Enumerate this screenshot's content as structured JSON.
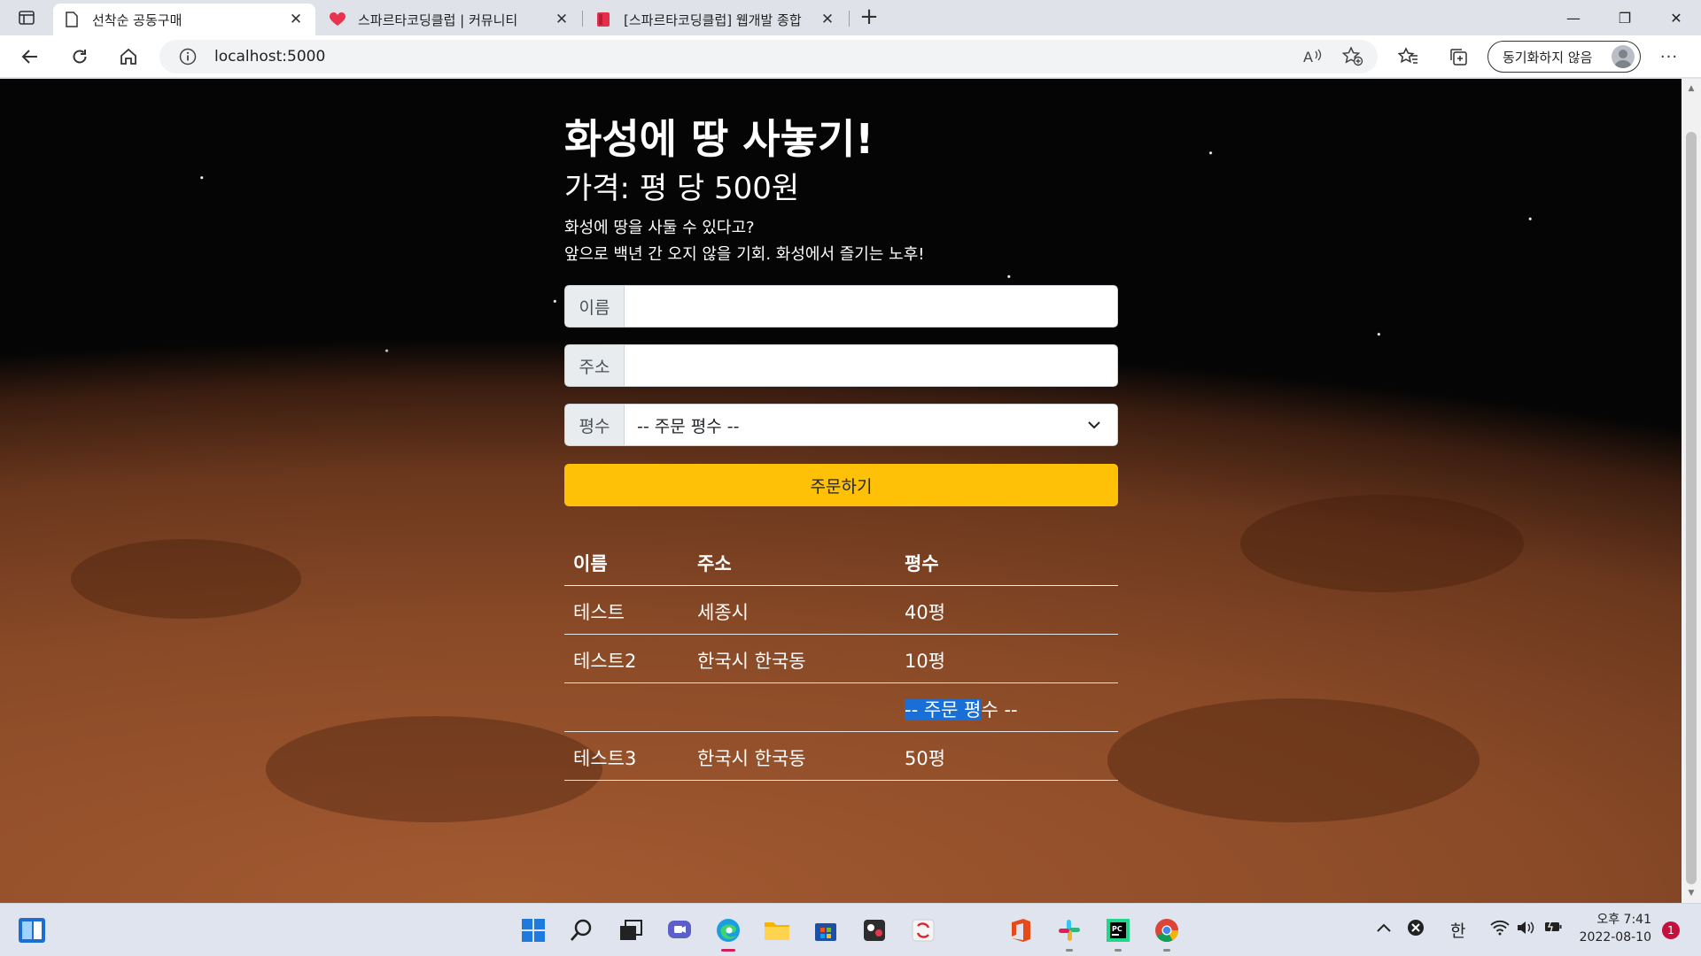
{
  "browser": {
    "tabs": [
      {
        "title": "선착순 공동구매",
        "active": true
      },
      {
        "title": "스파르타코딩클럽 | 커뮤니티",
        "active": false
      },
      {
        "title": "[스파르타코딩클럽] 웹개발 종합",
        "active": false
      }
    ],
    "new_tab": "+",
    "close_glyph": "✕",
    "window": {
      "minimize": "—",
      "maximize": "❐",
      "close": "✕"
    },
    "address": "localhost:5000",
    "profile_label": "동기화하지 않음",
    "more_glyph": "···"
  },
  "page": {
    "title": "화성에 땅 사놓기!",
    "price": "가격: 평 당 500원",
    "desc_line1": "화성에 땅을 사둘 수 있다고?",
    "desc_line2": "앞으로 백년 간 오지 않을 기회. 화성에서 즐기는 노후!",
    "form": {
      "name_label": "이름",
      "name_value": "",
      "address_label": "주소",
      "address_value": "",
      "size_label": "평수",
      "size_selected": "-- 주문 평수 --"
    },
    "order_button": "주문하기",
    "table": {
      "headers": [
        "이름",
        "주소",
        "평수"
      ],
      "rows": [
        {
          "name": "테스트",
          "address": "세종시",
          "size": "40평"
        },
        {
          "name": "테스트2",
          "address": "한국시 한국동",
          "size": "10평"
        },
        {
          "name": "",
          "address": "",
          "size_selected": "-- 주문 평",
          "size_rest": "수 --"
        },
        {
          "name": "테스트3",
          "address": "한국시 한국동",
          "size": "50평"
        }
      ]
    }
  },
  "taskbar": {
    "ime": "한",
    "time": "오후 7:41",
    "date": "2022-08-10",
    "notifications": "1"
  },
  "colors": {
    "accent_button": "#ffc107",
    "selection": "#1a6fd6"
  }
}
